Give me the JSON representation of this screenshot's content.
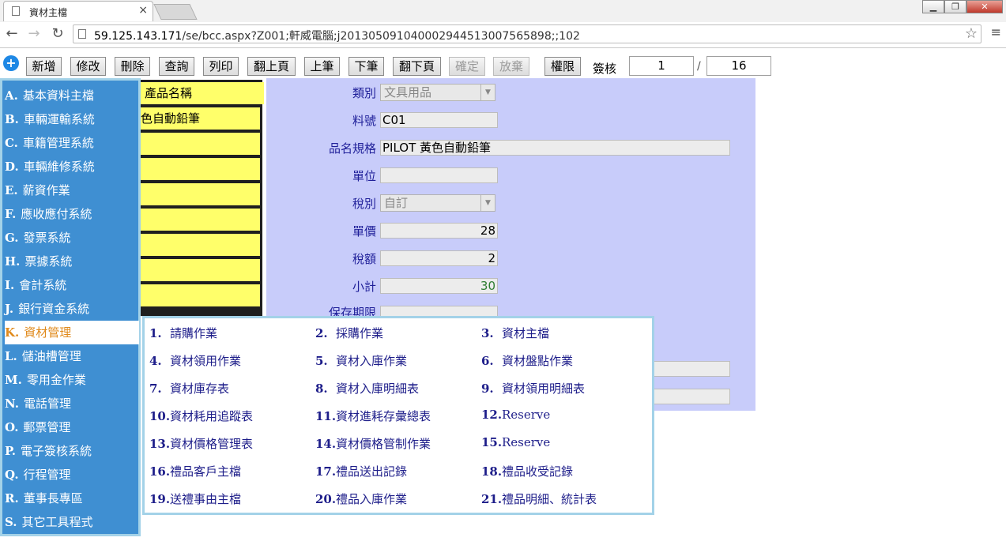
{
  "browser": {
    "tab_title": "資材主檔",
    "tab_close": "×",
    "url_host": "59.125.143.171",
    "url_path": "/se/bcc.aspx?Z001;軒威電腦;j20130509104000294451300756589​8;;102",
    "win_min": "▁",
    "win_max": "❐",
    "win_close": "✕"
  },
  "toolbar": {
    "add": "新增",
    "edit": "修改",
    "delete": "刪除",
    "query": "查詢",
    "print": "列印",
    "page_up": "翻上頁",
    "prev": "上筆",
    "next": "下筆",
    "page_down": "翻下頁",
    "confirm": "確定",
    "discard": "放棄",
    "permission": "權限",
    "sign_label": "簽核",
    "page_current": "1",
    "page_sep": "/",
    "page_total": "16"
  },
  "sidebar": {
    "items": [
      {
        "key": "A.",
        "label": "基本資料主檔"
      },
      {
        "key": "B.",
        "label": "車輛運輸系統"
      },
      {
        "key": "C.",
        "label": "車籍管理系統"
      },
      {
        "key": "D.",
        "label": "車輛維修系統"
      },
      {
        "key": "E.",
        "label": "薪資作業"
      },
      {
        "key": "F.",
        "label": "應收應付系統"
      },
      {
        "key": "G.",
        "label": "發票系統"
      },
      {
        "key": "H.",
        "label": "票據系統"
      },
      {
        "key": "I.",
        "label": "會計系統"
      },
      {
        "key": "J.",
        "label": "銀行資金系統"
      },
      {
        "key": "K.",
        "label": "資材管理"
      },
      {
        "key": "L.",
        "label": "儲油槽管理"
      },
      {
        "key": "M.",
        "label": "零用金作業"
      },
      {
        "key": "N.",
        "label": "電話管理"
      },
      {
        "key": "O.",
        "label": "郵票管理"
      },
      {
        "key": "P.",
        "label": "電子簽核系統"
      },
      {
        "key": "Q.",
        "label": "行程管理"
      },
      {
        "key": "R.",
        "label": "董事長專區"
      },
      {
        "key": "S.",
        "label": "其它工具程式"
      }
    ]
  },
  "list": {
    "header": "產品名稱",
    "rows": [
      "色自動鉛筆"
    ]
  },
  "form": {
    "category_label": "類別",
    "category_value": "文具用品",
    "code_label": "料號",
    "code_value": "C01",
    "name_label": "品名規格",
    "name_value": "PILOT 黃色自動鉛筆",
    "unit_label": "單位",
    "unit_value": "",
    "tax_type_label": "稅別",
    "tax_type_value": "自訂",
    "price_label": "單價",
    "price_value": "28",
    "tax_label": "稅額",
    "tax_value": "2",
    "subtotal_label": "小計",
    "subtotal_value": "30",
    "expiry_label": "保存期限"
  },
  "submenu": {
    "items": [
      {
        "num": "1.",
        "label": "請購作業"
      },
      {
        "num": "2.",
        "label": "採購作業"
      },
      {
        "num": "3.",
        "label": "資材主檔"
      },
      {
        "num": "4.",
        "label": "資材領用作業"
      },
      {
        "num": "5.",
        "label": "資材入庫作業"
      },
      {
        "num": "6.",
        "label": "資材盤點作業"
      },
      {
        "num": "7.",
        "label": "資材庫存表"
      },
      {
        "num": "8.",
        "label": "資材入庫明細表"
      },
      {
        "num": "9.",
        "label": "資材領用明細表"
      },
      {
        "num": "10.",
        "label": "資材耗用追蹤表"
      },
      {
        "num": "11.",
        "label": "資材進耗存彙總表"
      },
      {
        "num": "12.",
        "label": "Reserve"
      },
      {
        "num": "13.",
        "label": "資材價格管理表"
      },
      {
        "num": "14.",
        "label": "資材價格管制作業"
      },
      {
        "num": "15.",
        "label": "Reserve"
      },
      {
        "num": "16.",
        "label": "禮品客戶主檔"
      },
      {
        "num": "17.",
        "label": "禮品送出記錄"
      },
      {
        "num": "18.",
        "label": "禮品收受記錄"
      },
      {
        "num": "19.",
        "label": "送禮事由主檔"
      },
      {
        "num": "20.",
        "label": "禮品入庫作業"
      },
      {
        "num": "21.",
        "label": "禮品明細、統計表"
      }
    ]
  },
  "colors": {
    "sidebar_bg": "#3f8fd2",
    "sidebar_active_text": "#e08a1c",
    "form_bg": "#c8ccfa",
    "list_bg": "#ffff6a",
    "subtotal_color": "#2e7d32"
  }
}
